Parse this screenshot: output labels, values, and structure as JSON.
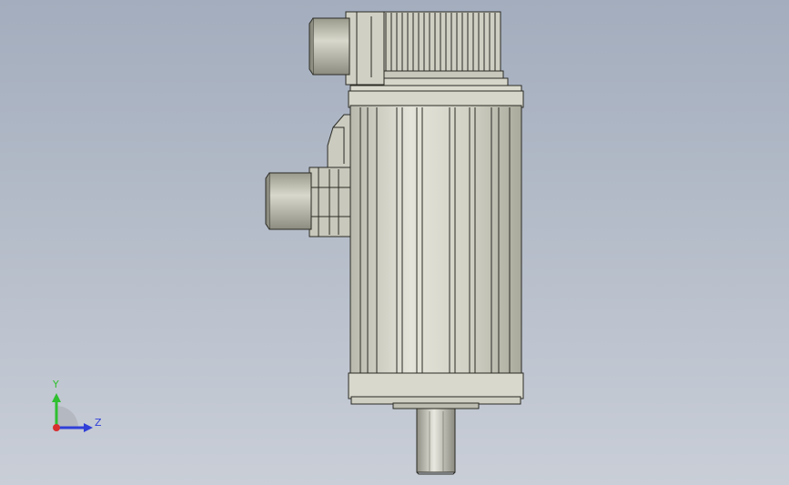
{
  "viewport": {
    "background_top": "#a3adbd",
    "background_bottom": "#c9ced7"
  },
  "model": {
    "body_color": "#d2d2c6",
    "shade_color": "#9c9c8e",
    "edge_color": "#2a2a24"
  },
  "triad": {
    "y_label": "Y",
    "z_label": "Z",
    "y_color": "#2fbf2f",
    "z_color": "#2f3fd8",
    "x_color": "#d82f2f"
  }
}
